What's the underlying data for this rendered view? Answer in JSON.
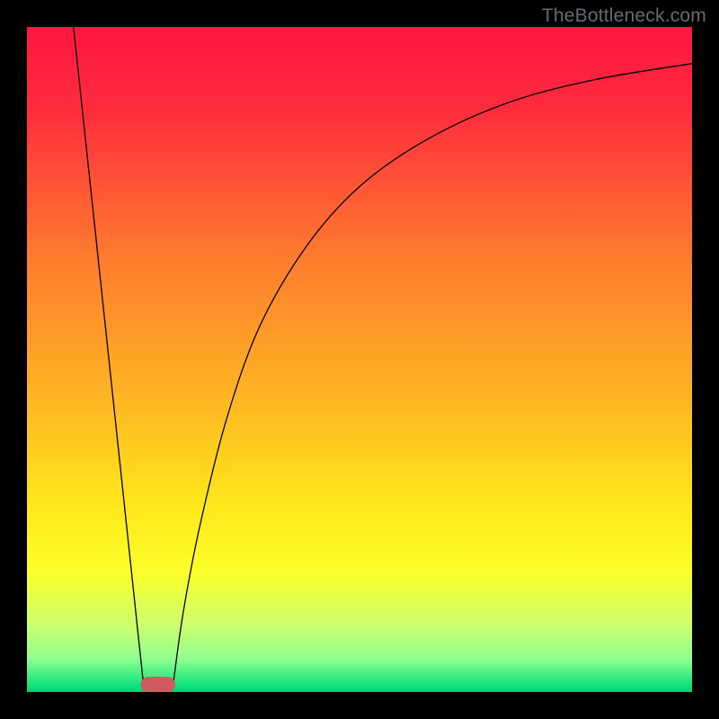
{
  "watermark": "TheBottleneck.com",
  "chart_data": {
    "type": "line",
    "xlim": [
      0,
      100
    ],
    "ylim": [
      0,
      100
    ],
    "background_gradient": {
      "stops": [
        {
          "at": 0.0,
          "color": "#ff1640"
        },
        {
          "at": 0.12,
          "color": "#ff2b3d"
        },
        {
          "at": 0.35,
          "color": "#ff7c2e"
        },
        {
          "at": 0.55,
          "color": "#ffb323"
        },
        {
          "at": 0.72,
          "color": "#ffe71b"
        },
        {
          "at": 0.82,
          "color": "#fbff2a"
        },
        {
          "at": 0.9,
          "color": "#ccff6d"
        },
        {
          "at": 0.95,
          "color": "#90ff90"
        },
        {
          "at": 0.995,
          "color": "#00e077"
        },
        {
          "at": 1.0,
          "color": "#00c76a"
        }
      ]
    },
    "series": [
      {
        "name": "left-segment",
        "kind": "line",
        "points": [
          {
            "x": 7.0,
            "y": 100.0
          },
          {
            "x": 17.5,
            "y": 1.3
          }
        ]
      },
      {
        "name": "right-curve",
        "kind": "curve",
        "points": [
          {
            "x": 22.0,
            "y": 1.3
          },
          {
            "x": 23.5,
            "y": 12.0
          },
          {
            "x": 26.0,
            "y": 25.0
          },
          {
            "x": 30.0,
            "y": 41.0
          },
          {
            "x": 35.0,
            "y": 55.0
          },
          {
            "x": 42.0,
            "y": 67.0
          },
          {
            "x": 50.0,
            "y": 76.0
          },
          {
            "x": 60.0,
            "y": 83.0
          },
          {
            "x": 72.0,
            "y": 88.5
          },
          {
            "x": 85.0,
            "y": 92.0
          },
          {
            "x": 100.0,
            "y": 94.5
          }
        ]
      }
    ],
    "marker": {
      "name": "target-marker",
      "center_x": 19.7,
      "y": 1.1,
      "width": 5.2,
      "height": 2.4,
      "rx": 1.2,
      "color": "#cf5b5e"
    },
    "title": "",
    "xlabel": "",
    "ylabel": ""
  }
}
